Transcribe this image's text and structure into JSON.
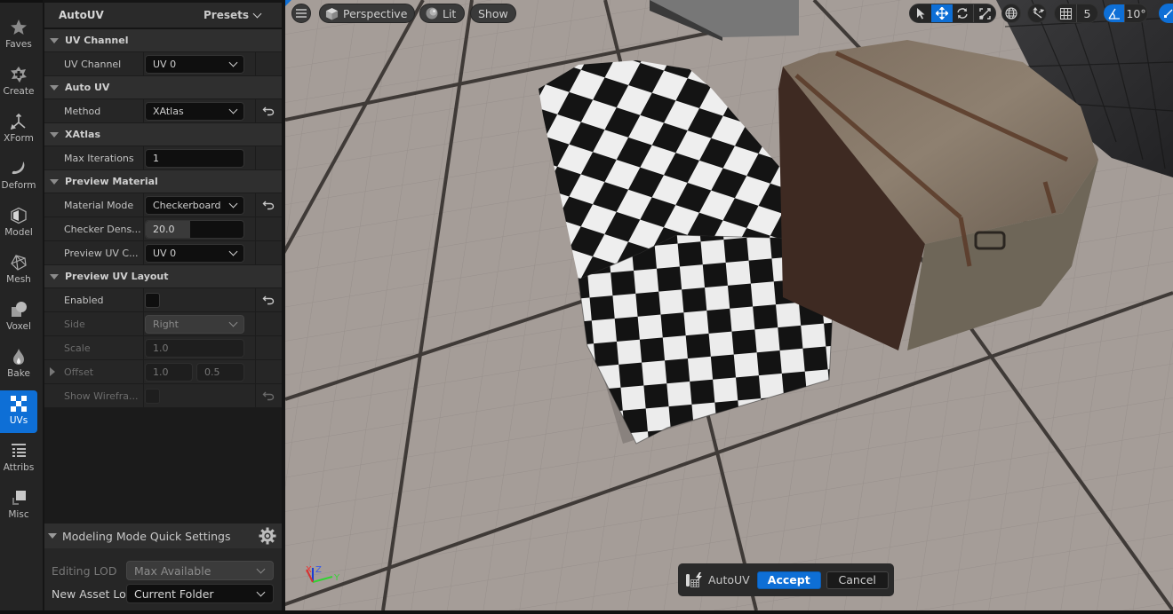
{
  "categories": [
    {
      "id": "faves",
      "label": "Faves",
      "icon": "star-icon"
    },
    {
      "id": "create",
      "label": "Create",
      "icon": "create-plus-icon"
    },
    {
      "id": "xform",
      "label": "XForm",
      "icon": "transform-axes-icon"
    },
    {
      "id": "deform",
      "label": "Deform",
      "icon": "deform-crescent-icon"
    },
    {
      "id": "model",
      "label": "Model",
      "icon": "model-hexagon-icon"
    },
    {
      "id": "mesh",
      "label": "Mesh",
      "icon": "mesh-pentagon-icon"
    },
    {
      "id": "voxel",
      "label": "Voxel",
      "icon": "voxel-shapes-icon"
    },
    {
      "id": "bake",
      "label": "Bake",
      "icon": "bake-flame-icon"
    },
    {
      "id": "uvs",
      "label": "UVs",
      "icon": "uv-checker-icon",
      "active": true
    },
    {
      "id": "attribs",
      "label": "Attribs",
      "icon": "attribs-list-icon"
    },
    {
      "id": "misc",
      "label": "Misc",
      "icon": "misc-squares-icon"
    }
  ],
  "panel": {
    "title": "AutoUV",
    "presets_label": "Presets",
    "sections": {
      "uv_channel": {
        "title": "UV Channel",
        "uv_channel": {
          "label": "UV Channel",
          "value": "UV 0"
        }
      },
      "auto_uv": {
        "title": "Auto UV",
        "method": {
          "label": "Method",
          "value": "XAtlas"
        }
      },
      "xatlas": {
        "title": "XAtlas",
        "max_iterations": {
          "label": "Max Iterations",
          "value": "1"
        }
      },
      "preview_material": {
        "title": "Preview Material",
        "material_mode": {
          "label": "Material Mode",
          "value": "Checkerboard"
        },
        "checker_density": {
          "label": "Checker Dens...",
          "value": "20.0",
          "slider_fraction": 0.45
        },
        "preview_uv_channel": {
          "label": "Preview UV C...",
          "value": "UV 0"
        }
      },
      "preview_uv_layout": {
        "title": "Preview UV Layout",
        "enabled": {
          "label": "Enabled",
          "checked": false
        },
        "side": {
          "label": "Side",
          "value": "Right"
        },
        "scale": {
          "label": "Scale",
          "value": "1.0"
        },
        "offset": {
          "label": "Offset",
          "x": "1.0",
          "y": "0.5"
        },
        "show_wireframe": {
          "label": "Show Wirefra...",
          "checked": false
        }
      }
    },
    "quick_settings": {
      "title": "Modeling Mode Quick Settings",
      "editing_lod": {
        "label": "Editing LOD",
        "value": "Max Available"
      },
      "new_asset_location": {
        "label": "New Asset Loc",
        "value": "Current Folder"
      }
    }
  },
  "viewport": {
    "menu_icon": "hamburger-icon",
    "view_mode": "Perspective",
    "lighting": "Lit",
    "show_label": "Show",
    "grid_snap_value": "5",
    "rotation_snap_value": "10°",
    "axis_labels": {
      "x": "X",
      "y": "Y",
      "z": "Z"
    },
    "accent_color": "#0e6fd6"
  },
  "tool_bar": {
    "tool_name": "AutoUV",
    "accept_label": "Accept",
    "cancel_label": "Cancel"
  }
}
